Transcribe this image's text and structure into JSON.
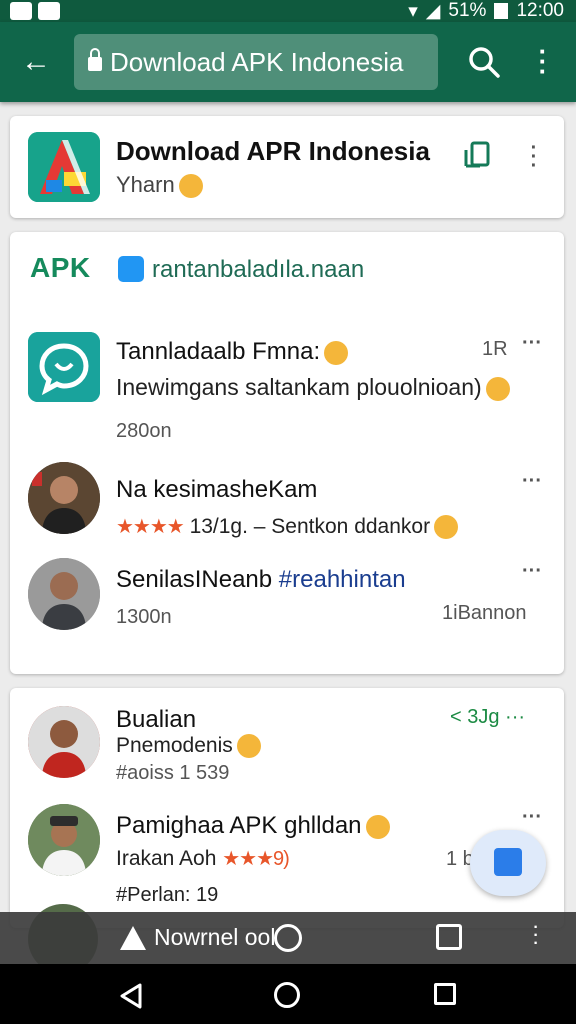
{
  "status_bar": {
    "battery_text": "51%",
    "time": "12:00"
  },
  "app_bar": {
    "url_text": "Download APK Indonesia"
  },
  "app_card": {
    "name": "Download APR Indonesia",
    "subtitle": "Yharn"
  },
  "feed_card": {
    "brand": "APK",
    "link_text": "rantanbaladıla.naan",
    "items": [
      {
        "title": "Tannladaalb Fmna:",
        "subtitle": "Inewimgans saltankam plouolnioan)",
        "meta": "280on",
        "right": "1R"
      },
      {
        "title": "Na kesimasheKam",
        "rating_text": "13/1g. – Sentkon ddankor",
        "stars": "★★★★"
      },
      {
        "title": "SenilasINeanb",
        "hashtag": "#reahhintan",
        "meta": "1300n",
        "right": "1iBannon"
      }
    ]
  },
  "bottom_card": {
    "items": [
      {
        "title": "Bualian",
        "subtitle": "Pnemodenis",
        "meta": "#aoiss 1 539",
        "right": "3Jg"
      },
      {
        "title": "Pamighaa APK ghlldan",
        "subtitle": "Irakan Aoh",
        "rating": "9)",
        "meta": "#Perlan: 19",
        "right": "1 b"
      }
    ]
  },
  "bottom_toolbar": {
    "text": "Nowrnel ool"
  }
}
